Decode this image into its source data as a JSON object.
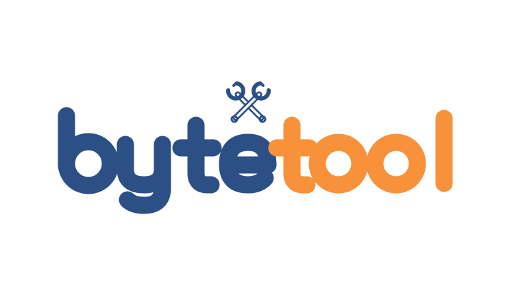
{
  "logo": {
    "wordmark": "bytetool",
    "part_1": "byte",
    "part_2": "tool",
    "colors": {
      "primary": "#2C4F86",
      "accent": "#F7923A",
      "background": "#FFFFFF"
    },
    "icon": "crossed-wrenches-icon"
  }
}
